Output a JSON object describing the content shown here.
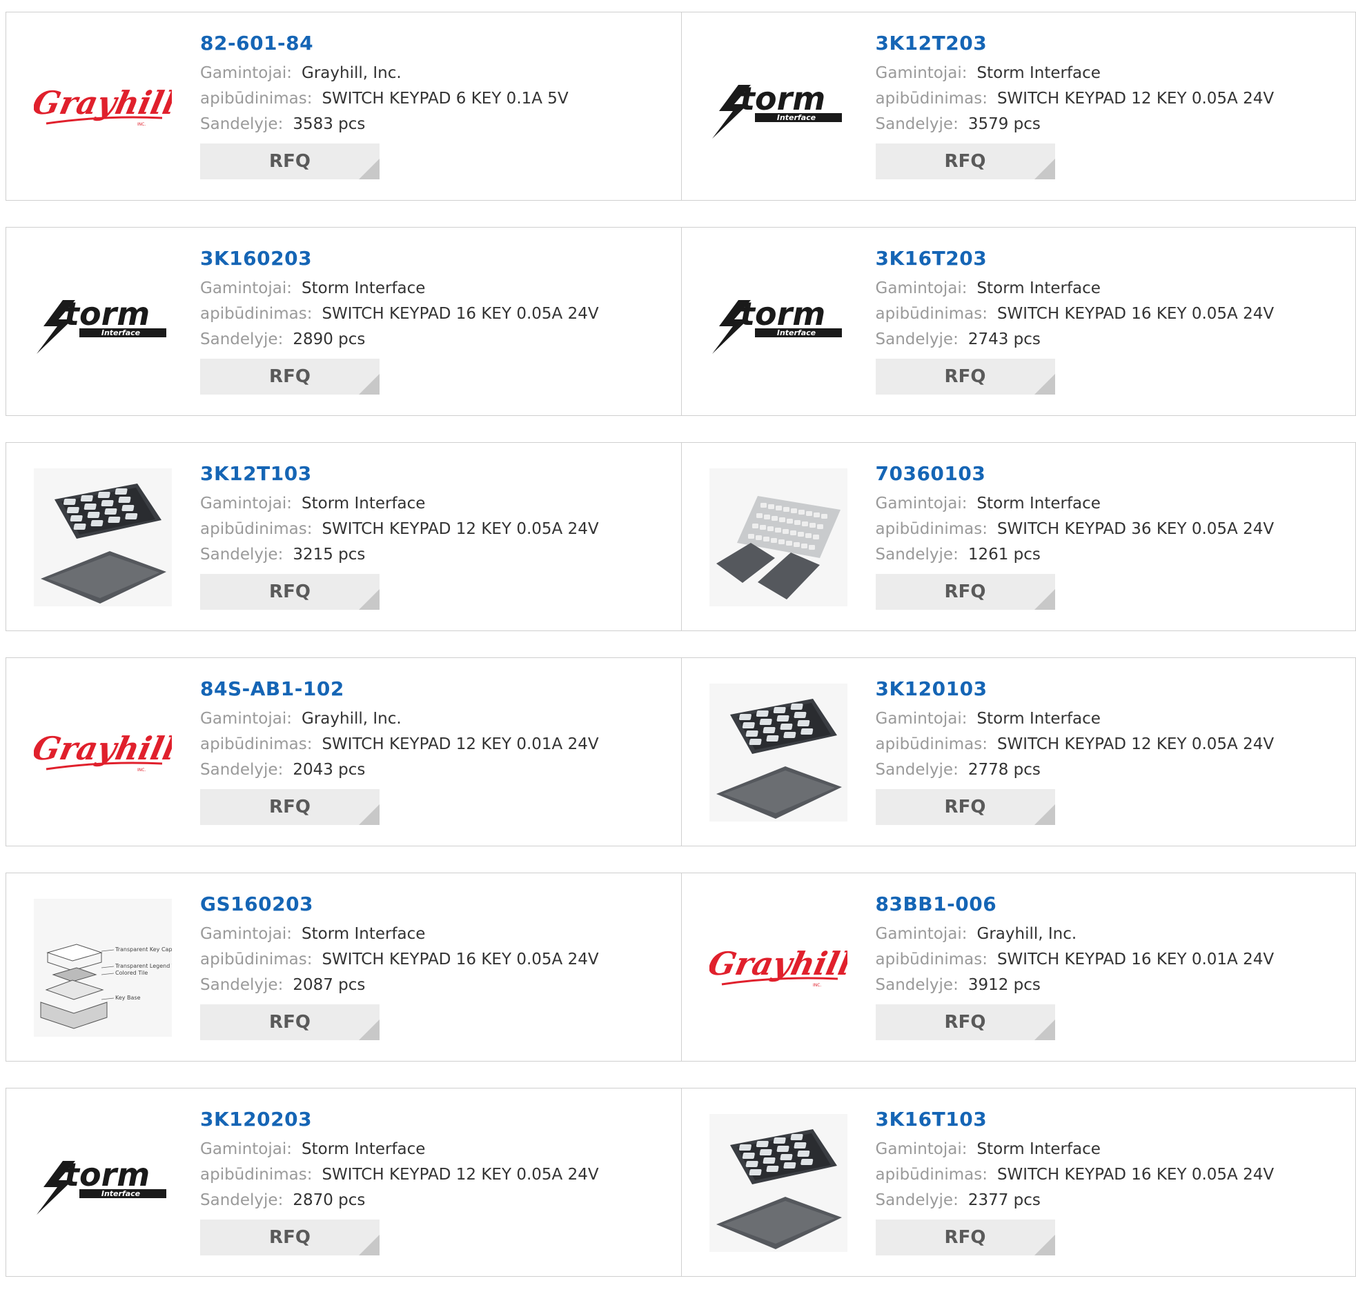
{
  "labels": {
    "manufacturer": "Gamintojai:",
    "description": "apibūdinimas:",
    "stock": "Sandelyje:",
    "rfq": "RFQ"
  },
  "logos": {
    "grayhill": {
      "name": "Grayhill",
      "sub": "INC.",
      "color": "#e0202c"
    },
    "storm": {
      "name": "torm",
      "sub": "Interface",
      "color": "#1a1a1a"
    }
  },
  "keypad_diagram": {
    "labels": [
      "Transparent Key Cap",
      "Transparent Legend Tile",
      "Colored Tile",
      "Key Base"
    ]
  },
  "products": [
    {
      "pn": "82-601-84",
      "manufacturer": "Grayhill, Inc.",
      "description": "SWITCH KEYPAD 6 KEY 0.1A 5V",
      "stock": "3583 pcs",
      "image": "grayhill-logo"
    },
    {
      "pn": "3K12T203",
      "manufacturer": "Storm Interface",
      "description": "SWITCH KEYPAD 12 KEY 0.05A 24V",
      "stock": "3579 pcs",
      "image": "storm-logo"
    },
    {
      "pn": "3K160203",
      "manufacturer": "Storm Interface",
      "description": "SWITCH KEYPAD 16 KEY 0.05A 24V",
      "stock": "2890 pcs",
      "image": "storm-logo"
    },
    {
      "pn": "3K16T203",
      "manufacturer": "Storm Interface",
      "description": "SWITCH KEYPAD 16 KEY 0.05A 24V",
      "stock": "2743 pcs",
      "image": "storm-logo"
    },
    {
      "pn": "3K12T103",
      "manufacturer": "Storm Interface",
      "description": "SWITCH KEYPAD 12 KEY 0.05A 24V",
      "stock": "3215 pcs",
      "image": "keypad-photo"
    },
    {
      "pn": "70360103",
      "manufacturer": "Storm Interface",
      "description": "SWITCH KEYPAD 36 KEY 0.05A 24V",
      "stock": "1261 pcs",
      "image": "keyboard-photo"
    },
    {
      "pn": "84S-AB1-102",
      "manufacturer": "Grayhill, Inc.",
      "description": "SWITCH KEYPAD 12 KEY 0.01A 24V",
      "stock": "2043 pcs",
      "image": "grayhill-logo"
    },
    {
      "pn": "3K120103",
      "manufacturer": "Storm Interface",
      "description": "SWITCH KEYPAD 12 KEY 0.05A 24V",
      "stock": "2778 pcs",
      "image": "keypad-photo"
    },
    {
      "pn": "GS160203",
      "manufacturer": "Storm Interface",
      "description": "SWITCH KEYPAD 16 KEY 0.05A 24V",
      "stock": "2087 pcs",
      "image": "keypad-diagram"
    },
    {
      "pn": "83BB1-006",
      "manufacturer": "Grayhill, Inc.",
      "description": "SWITCH KEYPAD 16 KEY 0.01A 24V",
      "stock": "3912 pcs",
      "image": "grayhill-logo"
    },
    {
      "pn": "3K120203",
      "manufacturer": "Storm Interface",
      "description": "SWITCH KEYPAD 12 KEY 0.05A 24V",
      "stock": "2870 pcs",
      "image": "storm-logo"
    },
    {
      "pn": "3K16T103",
      "manufacturer": "Storm Interface",
      "description": "SWITCH KEYPAD 16 KEY 0.05A 24V",
      "stock": "2377 pcs",
      "image": "keypad-photo"
    }
  ]
}
